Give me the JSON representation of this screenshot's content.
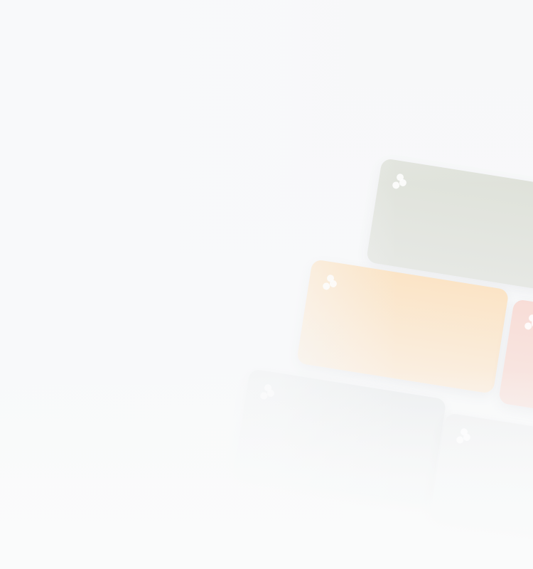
{
  "cards": [
    {
      "id": "card-1",
      "color": "#dfe2da",
      "color_end": "#e6e8e4",
      "icon": "cluster-dots-icon"
    },
    {
      "id": "card-2",
      "color": "#fbe4c6",
      "color_end": "#faefe2",
      "icon": "cluster-dots-icon"
    },
    {
      "id": "card-3",
      "color": "#f8ddd7",
      "color_end": "#f8e8e4",
      "icon": "cluster-dots-icon"
    },
    {
      "id": "card-4",
      "color": "#edeff0",
      "color_end": "#f2f3f4",
      "icon": "cluster-dots-icon"
    },
    {
      "id": "card-5",
      "color": "#f0f1f2",
      "color_end": "#f4f5f6",
      "icon": "cluster-dots-icon"
    }
  ],
  "background_color": "#f8f9fa"
}
